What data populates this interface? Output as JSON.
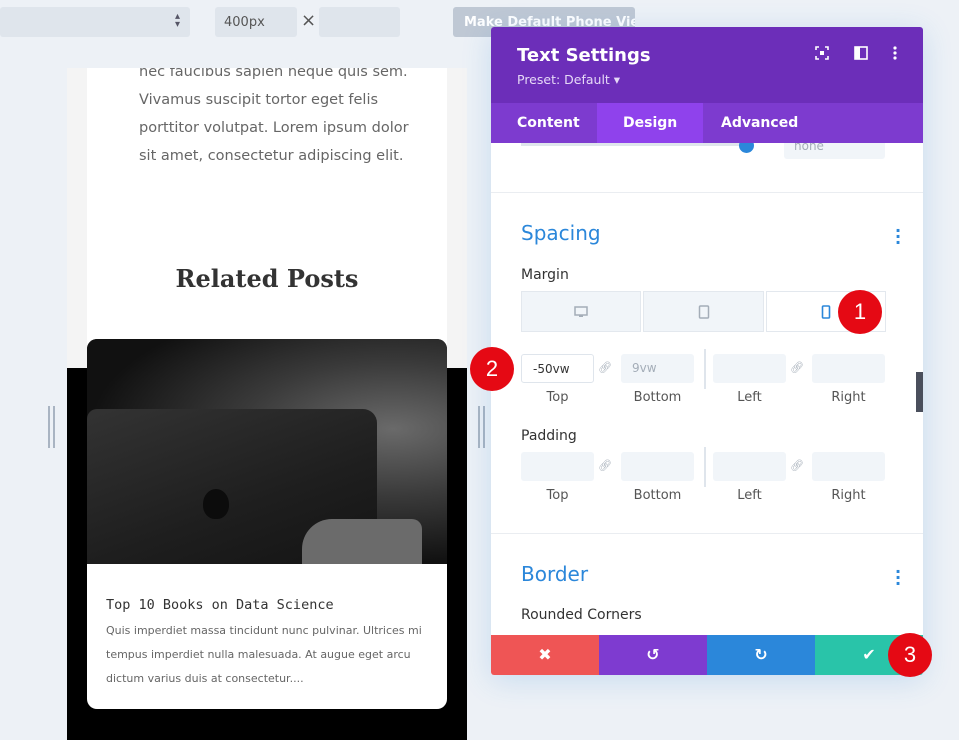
{
  "toolbar": {
    "width_value": "400px",
    "dimension_separator": "×",
    "make_default_label": "Make Default Phone View"
  },
  "preview": {
    "body_text": "nec faucibus sapien neque quis sem. Vivamus suscipit tortor eget felis porttitor volutpat. Lorem ipsum dolor sit amet, consectetur adipiscing elit.",
    "related_heading": "Related Posts",
    "post_title": "Top 10 Books on Data Science",
    "post_excerpt": "Quis imperdiet massa tincidunt nunc pulvinar. Ultrices mi tempus imperdiet nulla malesuada. At augue eget arcu dictum varius duis at consectetur...."
  },
  "panel": {
    "title": "Text Settings",
    "preset": "Preset: Default ▾",
    "tabs": [
      {
        "label": "Content"
      },
      {
        "label": "Design"
      },
      {
        "label": "Advanced"
      }
    ],
    "active_tab": "Design",
    "scrolled_input_placeholder": "none",
    "spacing": {
      "title": "Spacing",
      "margin_label": "Margin",
      "margin": {
        "top": "-50vw",
        "bottom_placeholder": "9vw",
        "left": "",
        "right": ""
      },
      "padding_label": "Padding",
      "sublabels": {
        "top": "Top",
        "bottom": "Bottom",
        "left": "Left",
        "right": "Right"
      }
    },
    "border": {
      "title": "Border",
      "rounded_corners_label": "Rounded Corners"
    },
    "footer": {
      "cancel": "✖",
      "undo": "↺",
      "redo": "↻",
      "save": "✔"
    }
  },
  "badges": [
    "1",
    "2",
    "3"
  ],
  "colors": {
    "header_purple": "#6c2eb9",
    "tab_bar_purple": "#7d3bcf",
    "active_tab_purple": "#8f42ec",
    "accent_blue": "#2b87da",
    "cancel_red": "#ef5555",
    "undo_purple": "#7e3bd0",
    "redo_blue": "#2b87da",
    "save_green": "#29c4a9",
    "badge_red": "#e50914"
  },
  "icons": {
    "select_arrows": "select-arrows-icon",
    "close_x": "close-icon",
    "expand": "expand-icon",
    "split_view": "split-view-icon",
    "more": "more-vertical-icon",
    "desktop": "desktop-icon",
    "tablet": "tablet-icon",
    "phone": "phone-icon",
    "link": "link-icon"
  }
}
